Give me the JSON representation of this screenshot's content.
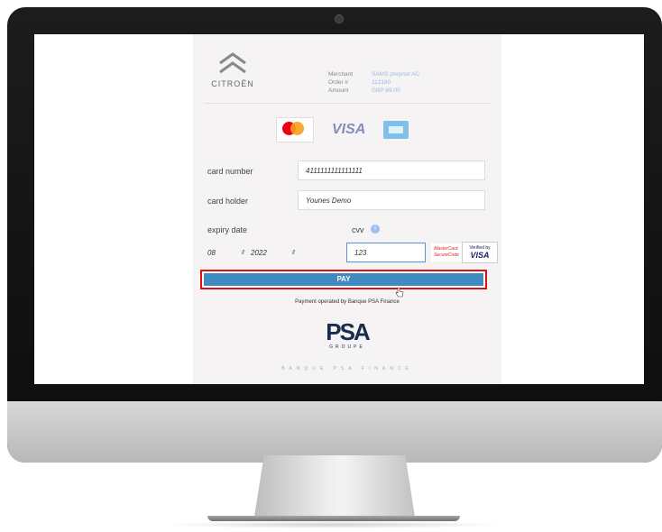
{
  "brand": {
    "name": "CITROËN"
  },
  "merchant": {
    "merchant_label": "Merchant",
    "merchant_value": "SAMS preprod AC",
    "order_label": "Order #",
    "order_value": "112180",
    "amount_label": "Amount",
    "amount_value": "GBP 69.00"
  },
  "accepted_cards": {
    "visa": "VISA"
  },
  "form": {
    "card_number_label": "card number",
    "card_number_value": "4111111111111111",
    "card_holder_label": "card holder",
    "card_holder_value": "Younes Demo",
    "expiry_label": "expiry date",
    "expiry_month": "08",
    "expiry_year": "2022",
    "cvv_label": "cvv",
    "cvv_value": "123"
  },
  "security_badges": {
    "mastercard_line1": "MasterCard.",
    "mastercard_line2": "SecureCode",
    "verified_by": "Verified by",
    "visa": "VISA"
  },
  "pay_button": {
    "label": "PAY"
  },
  "footer": {
    "operated_by": "Payment operated by Banque PSA Finance",
    "psa_logo": "PSA",
    "psa_groupe": "GROUPE",
    "bank_name": "BANQUE PSA FINANCE"
  },
  "colors": {
    "pay_button": "#3f8ac0",
    "highlight_border": "#e01010",
    "panel_bg": "#f5f3f3"
  }
}
